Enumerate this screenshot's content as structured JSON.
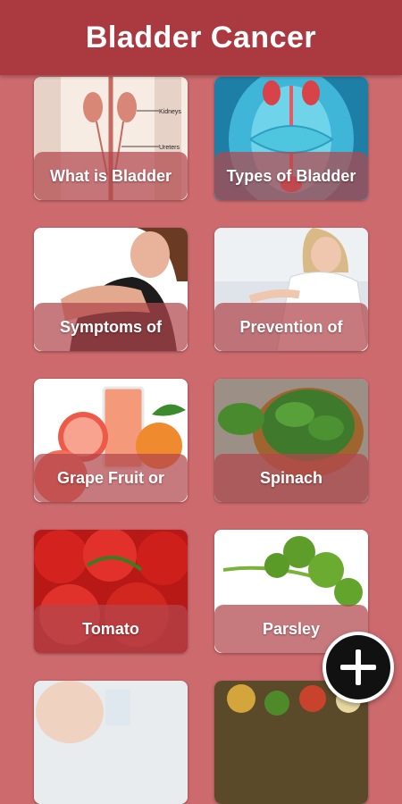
{
  "header": {
    "title": "Bladder Cancer"
  },
  "cards": [
    {
      "label": "What is Bladder",
      "image": "kidney-diagram-image"
    },
    {
      "label": "Types of Bladder",
      "image": "anatomy-render-image"
    },
    {
      "label": "Symptoms of",
      "image": "woman-stomach-pain-image"
    },
    {
      "label": "Prevention of",
      "image": "doctor-image"
    },
    {
      "label": "Grape Fruit or",
      "image": "grapefruit-juice-image"
    },
    {
      "label": "Spinach",
      "image": "spinach-bowl-image"
    },
    {
      "label": "Tomato",
      "image": "tomatoes-image"
    },
    {
      "label": "Parsley",
      "image": "parsley-image"
    },
    {
      "label": "",
      "image": "person-drinking-image"
    },
    {
      "label": "",
      "image": "vegetables-image"
    }
  ],
  "fab": {
    "icon": "plus-icon"
  },
  "colors": {
    "appbar": "#aa3a40",
    "background": "#cd6a6e",
    "fab": "#111111"
  }
}
